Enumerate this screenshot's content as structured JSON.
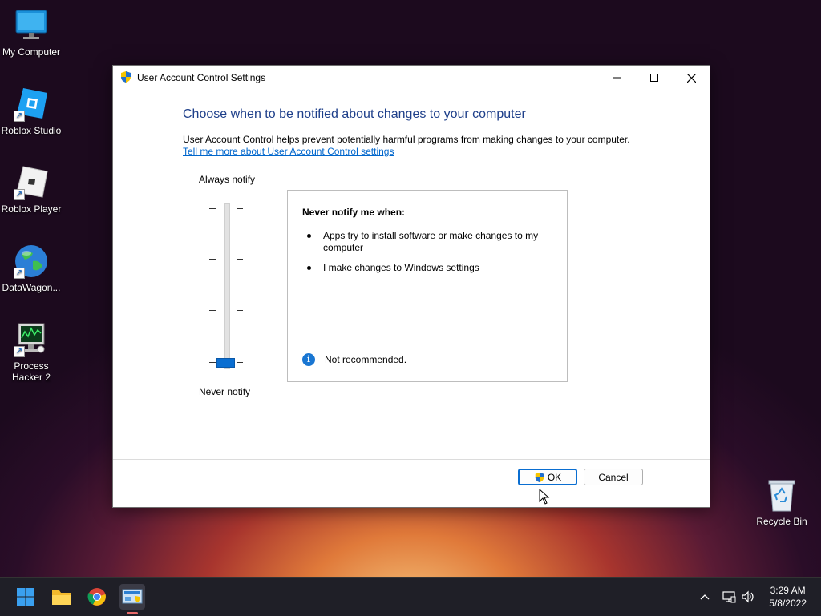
{
  "desktop": {
    "icons": [
      {
        "label": "My Computer"
      },
      {
        "label": "Roblox Studio"
      },
      {
        "label": "Roblox Player"
      },
      {
        "label": "DataWagon..."
      },
      {
        "label": "Process Hacker 2"
      },
      {
        "label": "Recycle Bin"
      }
    ]
  },
  "dialog": {
    "title": "User Account Control Settings",
    "heading": "Choose when to be notified about changes to your computer",
    "description": "User Account Control helps prevent potentially harmful programs from making changes to your computer.",
    "link": "Tell me more about User Account Control settings",
    "slider": {
      "top_label": "Always notify",
      "bottom_label": "Never notify",
      "levels": 4,
      "selected_level": 1
    },
    "info": {
      "header": "Never notify me when:",
      "bullets": [
        "Apps try to install software or make changes to my computer",
        "I make changes to Windows settings"
      ],
      "note": "Not recommended."
    },
    "buttons": {
      "ok": "OK",
      "cancel": "Cancel"
    }
  },
  "taskbar": {
    "time": "3:29 AM",
    "date": "5/8/2022"
  },
  "colors": {
    "accent": "#0a6ed1",
    "heading": "#1e3f8a",
    "link": "#0066cc"
  }
}
